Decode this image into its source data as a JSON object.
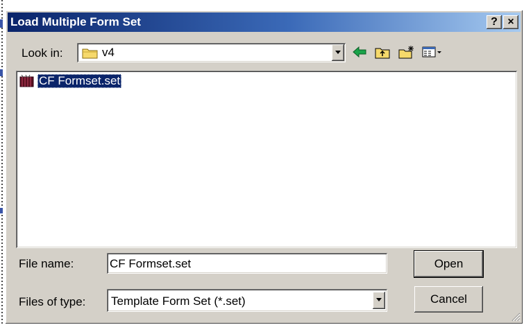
{
  "window": {
    "title": "Load Multiple Form Set"
  },
  "titlebar": {
    "help_label": "?",
    "close_label": "×"
  },
  "toolbar": {
    "look_in_label": "Look in:",
    "look_in_value": "v4",
    "icons": [
      "back-arrow-icon",
      "up-folder-icon",
      "new-folder-icon",
      "view-menu-icon"
    ]
  },
  "files": [
    {
      "name": "CF Formset.set",
      "icon": "formset-file-icon",
      "selected": true
    }
  ],
  "filename": {
    "label": "File name:",
    "value": "CF Formset.set"
  },
  "filetype": {
    "label": "Files of type:",
    "value": "Template Form Set (*.set)"
  },
  "buttons": {
    "open": "Open",
    "cancel": "Cancel"
  },
  "colors": {
    "title_start": "#0a246a",
    "title_end": "#a6caf0",
    "selection": "#0a246a",
    "face": "#d4d0c8"
  }
}
